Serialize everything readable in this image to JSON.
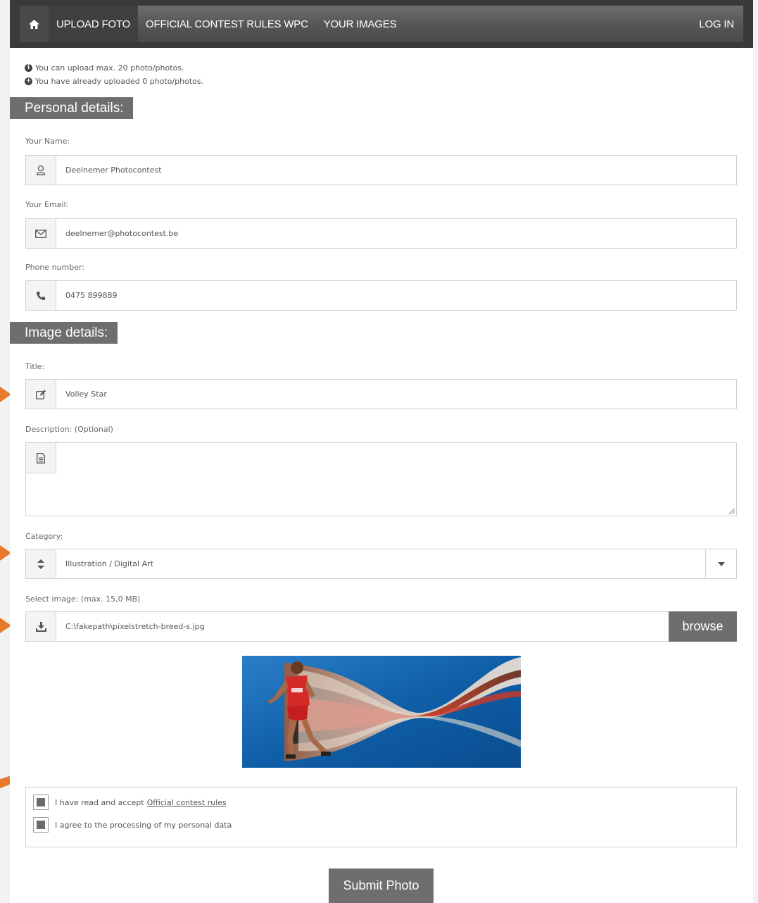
{
  "nav": {
    "home_icon": "home-icon",
    "items": [
      {
        "label": "UPLOAD FOTO",
        "active": true
      },
      {
        "label": "OFFICIAL CONTEST RULES WPC",
        "active": false
      },
      {
        "label": "YOUR IMAGES",
        "active": false
      }
    ],
    "login_label": "LOG IN"
  },
  "info": {
    "max_upload": "You can upload max. 20 photo/photos.",
    "already_uploaded": "You have already uploaded 0 photo/photos."
  },
  "personal": {
    "heading": "Personal details:",
    "name_label": "Your Name:",
    "name_value": "Deelnemer Photocontest",
    "email_label": "Your Email:",
    "email_value": "deelnemer@photocontest.be",
    "phone_label": "Phone number:",
    "phone_value": "0475 899889"
  },
  "image": {
    "heading": "Image details:",
    "title_label": "Title:",
    "title_value": "Volley Star",
    "description_label": "Description: (Optional)",
    "description_value": "",
    "category_label": "Category:",
    "category_value": "Illustration / Digital Art",
    "file_label": "Select image: (max. 15,0 MB)",
    "file_value": "C:\\fakepath\\pixelstretch-breed-s.jpg",
    "browse_label": "browse"
  },
  "consent": {
    "rules_text": "I have read and accept",
    "rules_link": "Official contest rules",
    "privacy_text": "I agree to the processing of my personal data"
  },
  "submit_label": "Submit Photo",
  "colors": {
    "accent_gray": "#6e6e6e",
    "arrow_orange": "#e87a2c",
    "nav_bg": "#555555"
  }
}
